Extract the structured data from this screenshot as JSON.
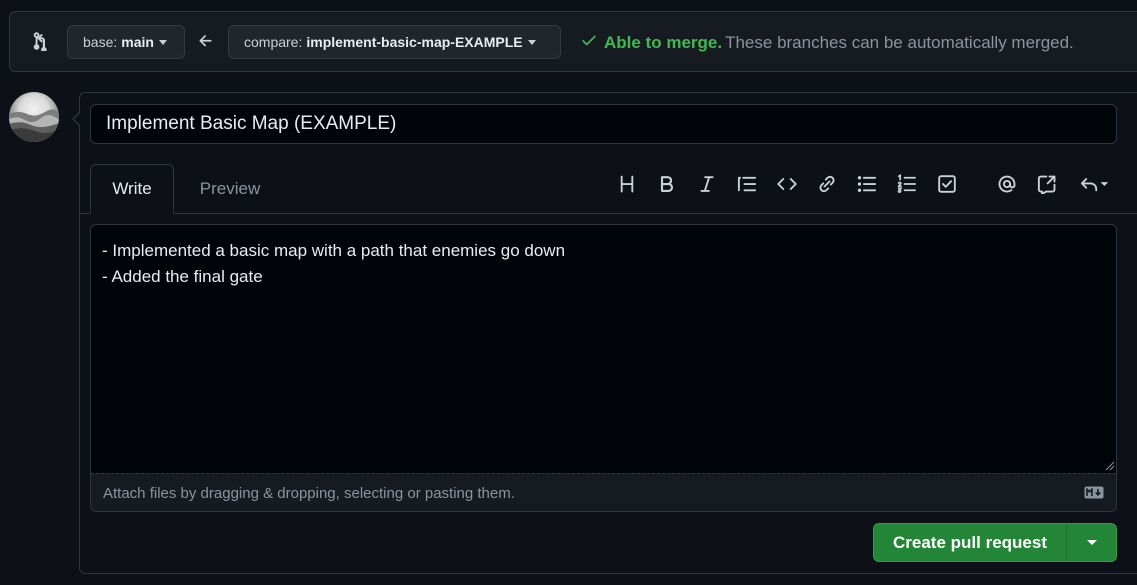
{
  "compare_bar": {
    "base_prefix": "base:",
    "base_branch": "main",
    "compare_prefix": "compare:",
    "compare_branch": "implement-basic-map-EXAMPLE",
    "merge_ok": "Able to merge.",
    "merge_message": "These branches can be automatically merged."
  },
  "form": {
    "title_value": "Implement Basic Map (EXAMPLE)",
    "tabs": [
      {
        "label": "Write",
        "active": true
      },
      {
        "label": "Preview",
        "active": false
      }
    ],
    "body_text": "- Implemented a basic map with a path that enemies go down\n- Added the final gate",
    "attach_hint": "Attach files by dragging & dropping, selecting or pasting them.",
    "toolbar_icons": [
      "heading-icon",
      "bold-icon",
      "italic-icon",
      "quote-icon",
      "code-icon",
      "link-icon",
      "unordered-list-icon",
      "ordered-list-icon",
      "task-list-icon",
      "mention-icon",
      "reference-icon",
      "saved-reply-icon"
    ]
  },
  "actions": {
    "create_label": "Create pull request"
  },
  "colors": {
    "background": "#0d1117",
    "success": "#3fb950",
    "primary_button": "#238636"
  }
}
